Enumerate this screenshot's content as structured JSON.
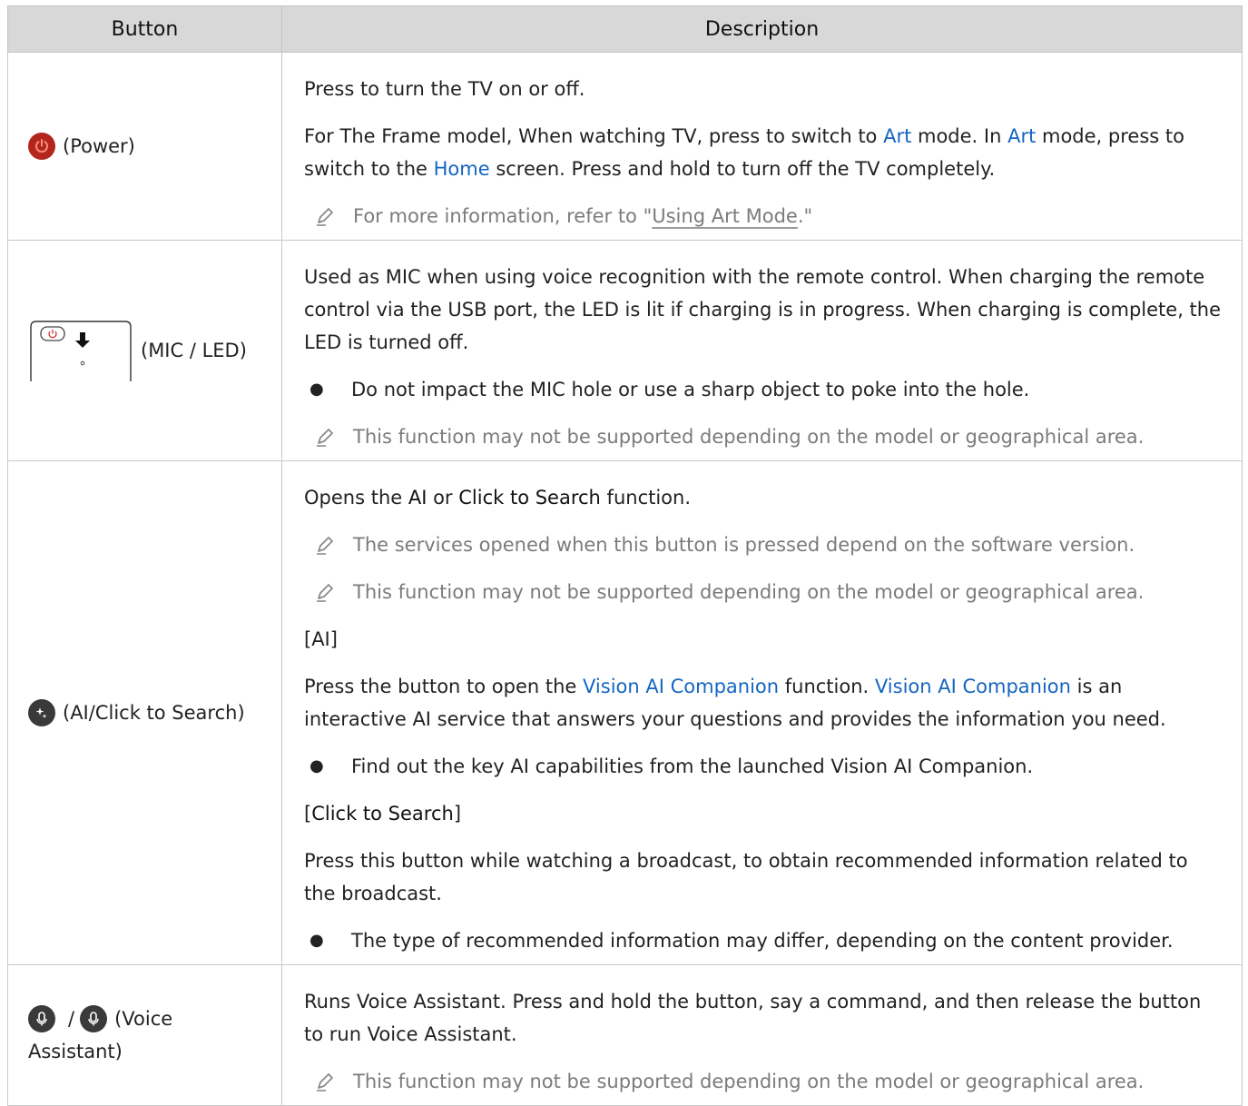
{
  "table": {
    "headers": [
      "Button",
      "Description"
    ]
  },
  "rows": [
    {
      "button_label": "(Power)",
      "desc": {
        "p1": "Press to turn the TV on or off.",
        "p2_a": "For The Frame model, When watching TV, press to switch to ",
        "p2_art1": "Art",
        "p2_b": " mode. In ",
        "p2_art2": "Art",
        "p2_c": " mode, press to switch to the ",
        "p2_home": "Home",
        "p2_d": " screen. Press and hold to turn off the TV completely.",
        "note_a": "For more information, refer to \"",
        "note_link": "Using Art Mode",
        "note_b": ".\""
      }
    },
    {
      "button_label": "(MIC / LED)",
      "desc": {
        "p1": "Used as MIC when using voice recognition with the remote control. When charging the remote control via the USB port, the LED is lit if charging is in progress. When charging is complete, the LED is turned off.",
        "bullet": "Do not impact the MIC hole or use a sharp object to poke into the hole.",
        "note": "This function may not be supported depending on the model or geographical area."
      }
    },
    {
      "button_label": "(AI/Click to Search)",
      "desc": {
        "p1_a": "Opens the ",
        "p1_ai": "AI",
        "p1_b": " or ",
        "p1_cts": "Click to Search",
        "p1_c": " function.",
        "note1": "The services opened when this button is pressed depend on the software version.",
        "note2": "This function may not be supported depending on the model or geographical area.",
        "h_ai": "[AI]",
        "p2_a": "Press the button to open the ",
        "p2_v1": "Vision AI Companion",
        "p2_b": " function. ",
        "p2_v2": "Vision AI Companion",
        "p2_c": " is an interactive AI service that answers your questions and provides the information you need.",
        "bullet1": "Find out the key AI capabilities from the launched Vision AI Companion.",
        "h_cts_open": "[",
        "h_cts": "Click to Search",
        "h_cts_close": "]",
        "p3": "Press this button while watching a broadcast, to obtain recommended information related to the broadcast.",
        "bullet2": "The type of recommended information may differ, depending on the content provider."
      }
    },
    {
      "button_slash": "/",
      "button_label_a": "(Voice",
      "button_label_b": "Assistant)",
      "desc": {
        "p1": "Runs Voice Assistant. Press and hold the button, say a command, and then release the button to run Voice Assistant.",
        "note": "This function may not be supported depending on the model or geographical area."
      }
    }
  ],
  "colors": {
    "header_bg": "#d8d8d8",
    "highlight": "#1565c0",
    "note_text": "#7b7b7b",
    "power_icon": "#b3261e",
    "dark_icon": "#3a3a3a"
  },
  "icons": [
    "power-icon",
    "mic-led-drawing",
    "ai-search-icon",
    "voice-assistant-icon",
    "note-pen-icon"
  ]
}
